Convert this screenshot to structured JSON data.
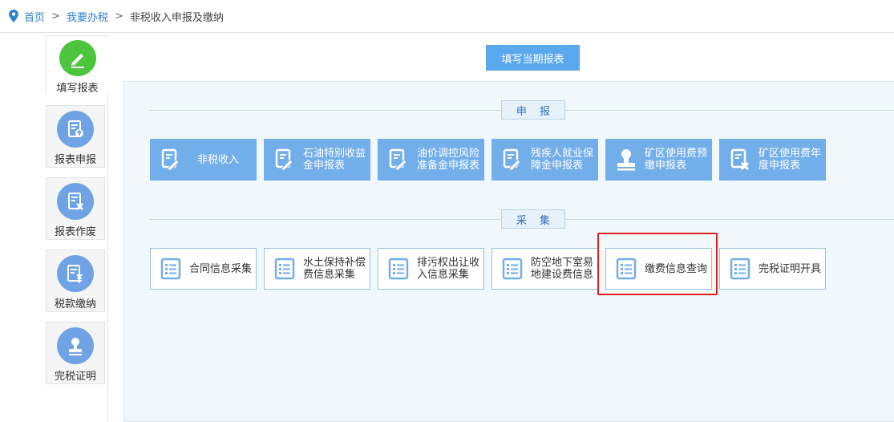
{
  "breadcrumb": {
    "home": "首页",
    "sep1": ">",
    "level2": "我要办税",
    "sep2": ">",
    "current": "非税收入申报及缴纳"
  },
  "sidebar": {
    "items": [
      {
        "label": "填写报表",
        "icon": "pencil-icon",
        "active": true
      },
      {
        "label": "报表申报",
        "icon": "report-upload-icon"
      },
      {
        "label": "报表作废",
        "icon": "report-void-icon"
      },
      {
        "label": "税款缴纳",
        "icon": "tax-payment-icon"
      },
      {
        "label": "完税证明",
        "icon": "stamp-icon"
      }
    ]
  },
  "main": {
    "fill_button": "填写当期报表",
    "sections": [
      {
        "title": "申 报",
        "tiles": [
          {
            "line1": "非税收入",
            "line2": "",
            "icon": "form-edit-icon"
          },
          {
            "line1": "石油特别收益",
            "line2": "金申报表",
            "icon": "form-edit-icon"
          },
          {
            "line1": "油价调控风险",
            "line2": "准备金申报表",
            "icon": "form-edit-icon"
          },
          {
            "line1": "残疾人就业保",
            "line2": "障金申报表",
            "icon": "form-edit-icon"
          },
          {
            "line1": "矿区使用费预",
            "line2": "缴申报表",
            "icon": "stamp-icon"
          },
          {
            "line1": "矿区使用费年",
            "line2": "度申报表",
            "icon": "form-void-icon"
          }
        ]
      },
      {
        "title": "采 集",
        "tiles": [
          {
            "line1": "合同信息采集",
            "line2": "",
            "icon": "list-icon"
          },
          {
            "line1": "水土保持补偿",
            "line2": "费信息采集",
            "icon": "list-icon"
          },
          {
            "line1": "排污权出让收",
            "line2": "入信息采集",
            "icon": "list-icon"
          },
          {
            "line1": "防空地下室易",
            "line2": "地建设费信息",
            "icon": "list-icon"
          },
          {
            "line1": "缴费信息查询",
            "line2": "",
            "icon": "list-icon",
            "highlighted": true
          },
          {
            "line1": "完税证明开具",
            "line2": "",
            "icon": "list-icon"
          }
        ]
      }
    ]
  },
  "colors": {
    "link": "#2f7fd1",
    "tile_blue": "#72aeea",
    "button_blue": "#5aa9ef",
    "active_green": "#4cc43c",
    "icon_circle": "#6fa3e6",
    "highlight_red": "#e02020",
    "panel_bg": "#f1f8fc"
  }
}
